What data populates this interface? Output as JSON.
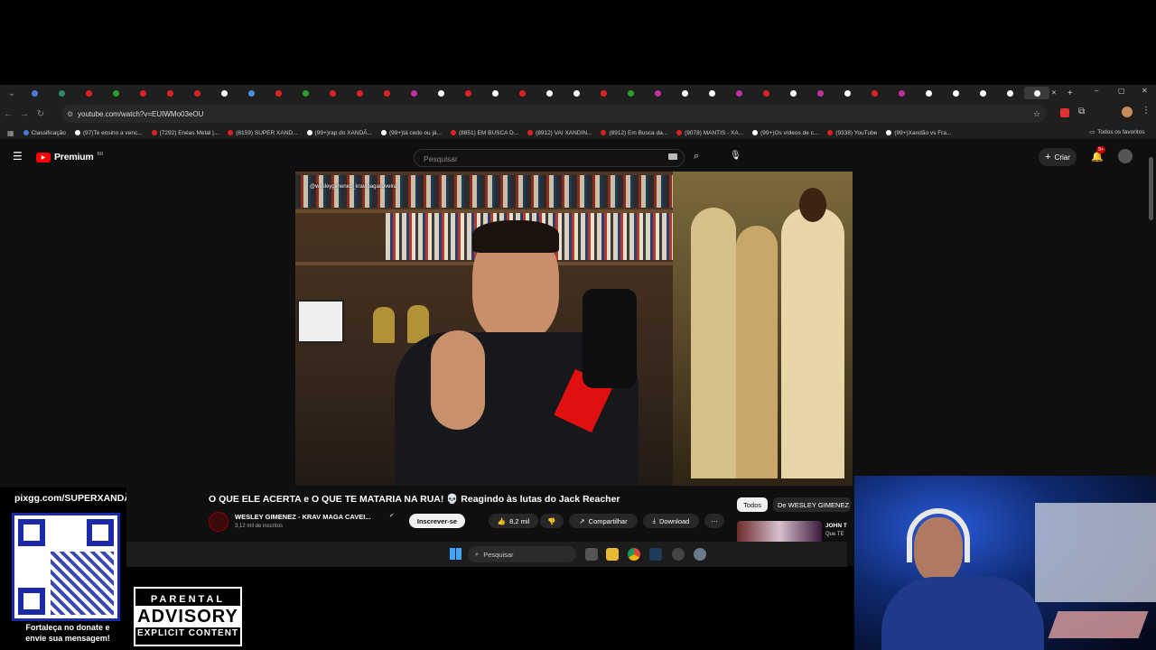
{
  "browser": {
    "tabs_count": 40,
    "url": "youtube.com/watch?v=EUIWMo03eOU",
    "bookmarks": [
      {
        "label": "Classificação",
        "color": "#4a7bd8"
      },
      {
        "label": "(97)Te ensino a venc...",
        "color": "#ffffff"
      },
      {
        "label": "(7292) Enéas Metal |...",
        "color": "#e02020"
      },
      {
        "label": "(8159) SUPER XAND...",
        "color": "#e02020"
      },
      {
        "label": "(99+)rap do XANDÃ...",
        "color": "#ffffff"
      },
      {
        "label": "(99+)tá cedo ou já...",
        "color": "#ffffff"
      },
      {
        "label": "(8851) EM BUSCA D...",
        "color": "#e02020"
      },
      {
        "label": "(8912) VAI XANDIN...",
        "color": "#e02020"
      },
      {
        "label": "(8912) Em Busca da...",
        "color": "#e02020"
      },
      {
        "label": "(9078) MANTIS - XA...",
        "color": "#e02020"
      },
      {
        "label": "(99+)Os vídeos de c...",
        "color": "#ffffff"
      },
      {
        "label": "(9338) YouTube",
        "color": "#e02020"
      },
      {
        "label": "(99+)Xandão vs Fra...",
        "color": "#ffffff"
      }
    ],
    "all_bookmarks": "Todos os favoritos"
  },
  "youtube": {
    "logo": "Premium",
    "logo_region": "BR",
    "search_placeholder": "Pesquisar",
    "create_label": "Criar",
    "notif_count": "9+",
    "video_watermark": "@wesleygimenez_kravmagacaveira",
    "video_title": "O QUE ELE ACERTA e O QUE TE MATARIA NA RUA! 💀 Reagindo às lutas do Jack Reacher",
    "channel_name": "WESLEY GIMENEZ - KRAV MAGA CAVEI...",
    "subscribers": "3,12 mil de inscritos",
    "subscribe_label": "Inscrever-se",
    "likes": "8,2 mil",
    "share_label": "Compartilhar",
    "download_label": "Download",
    "filter_all": "Todos",
    "filter_channel": "De WESLEY GIMENEZ",
    "rec_title": "JOHN T",
    "rec_sub": "Que TE"
  },
  "taskbar": {
    "search_placeholder": "Pesquisar"
  },
  "overlay": {
    "donate_url": "pixgg.com/SUPERXANDÃ",
    "donate_text_1": "Fortaleça no donate e",
    "donate_text_2": "envie sua mensagem!",
    "advisory_1": "PARENTAL",
    "advisory_2": "ADVISORY",
    "advisory_3": "EXPLICIT CONTENT"
  },
  "colors": {
    "youtube_red": "#ff0000",
    "accent_blue": "#3ea6ff"
  }
}
